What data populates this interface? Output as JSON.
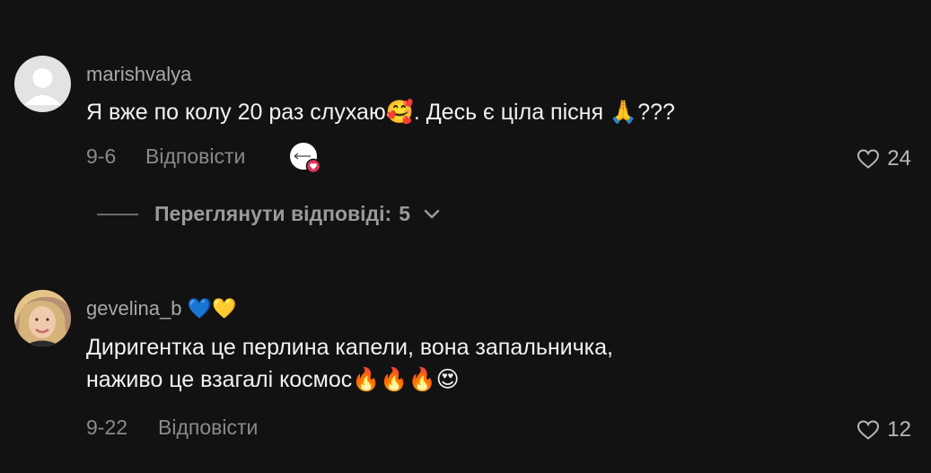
{
  "comments": [
    {
      "username": "marishvalya",
      "text": "Я вже по колу 20 раз слухаю🥰. Десь є ціла пісня 🙏???",
      "date": "9-6",
      "reply_label": "Відповісти",
      "likes": "24",
      "view_replies_label": "Переглянути відповіді:",
      "replies_count": "5"
    },
    {
      "username": "gevelina_b",
      "username_emoji": "💙💛",
      "text_line1": "Диригентка це перлина капели, вона запальничка,",
      "text_line2": "наживо це взагалі космос🔥🔥🔥😍",
      "date": "9-22",
      "reply_label": "Відповісти",
      "likes": "12"
    }
  ]
}
